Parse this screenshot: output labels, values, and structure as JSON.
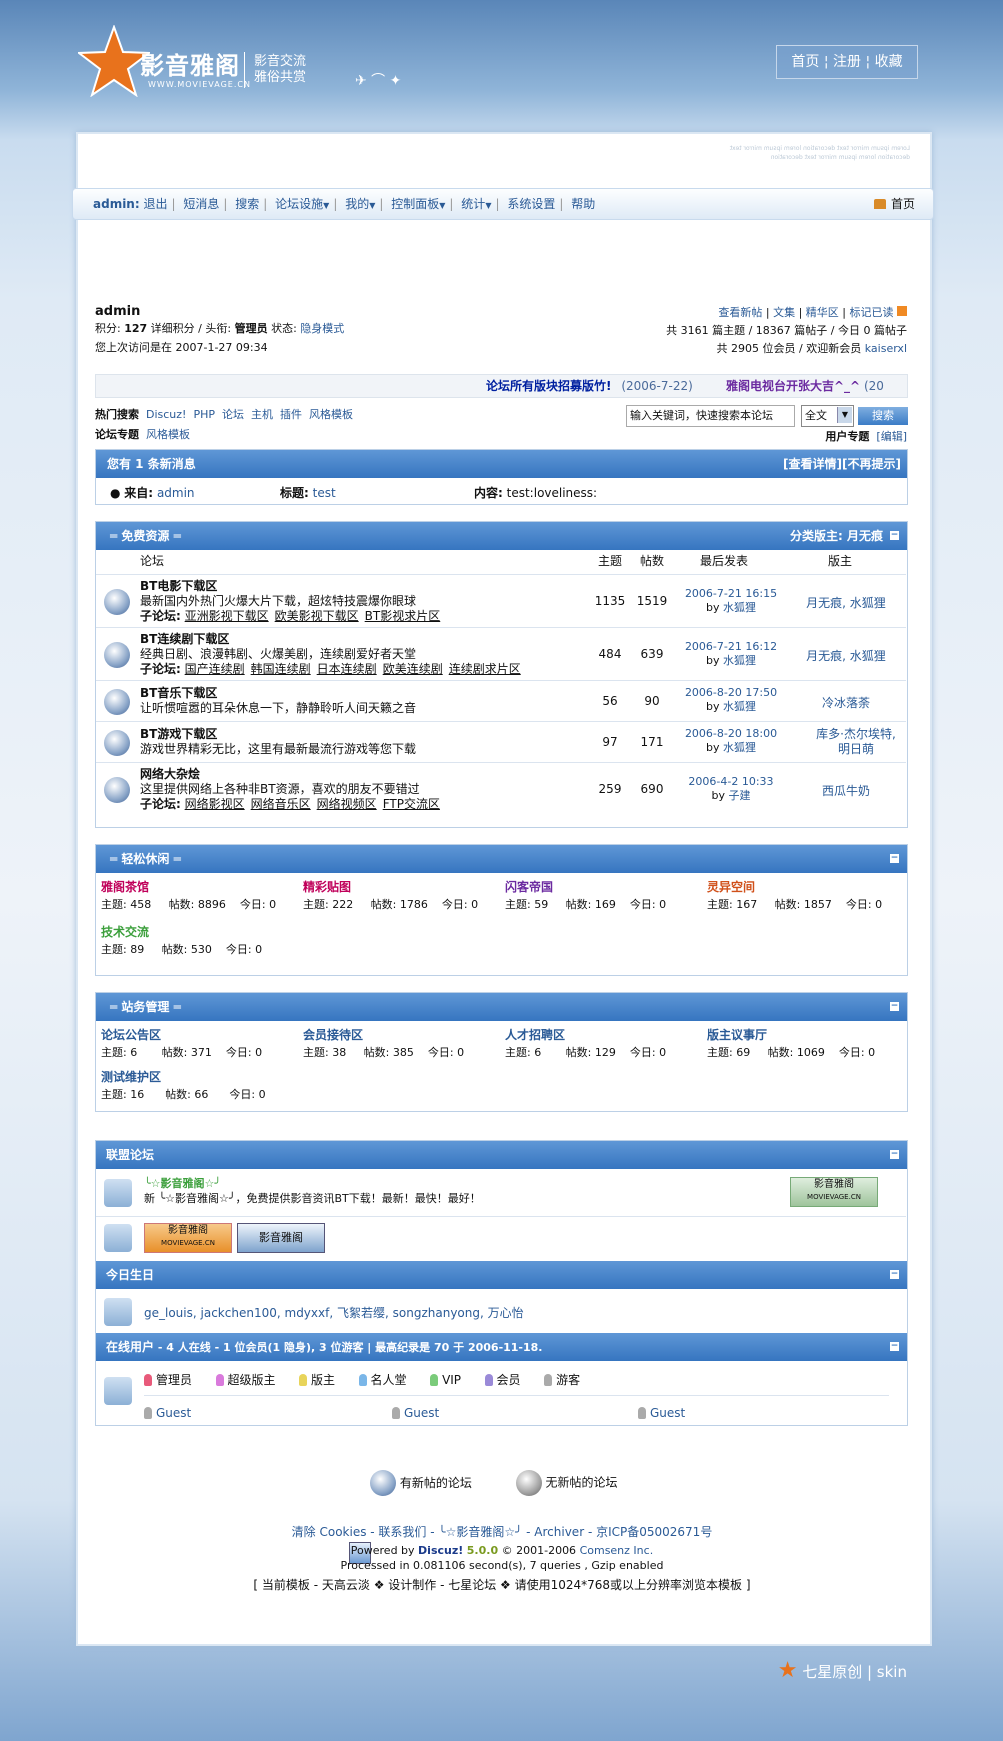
{
  "header": {
    "logo_text": "影音雅阁",
    "logo_url": "WWW.MOVIEVAGE.CN",
    "tagline1": "影音交流",
    "tagline2": "雅俗共赏",
    "toplinks": [
      "首页",
      "注册",
      "收藏"
    ]
  },
  "nav": {
    "user": "admin:",
    "items": [
      "退出",
      "短消息",
      "搜索",
      "论坛设施",
      "我的",
      "控制面板",
      "统计",
      "系统设置",
      "帮助"
    ],
    "home": "首页"
  },
  "user": {
    "name": "admin",
    "line1a": "积分: ",
    "points": "127",
    "line1b": " 详细积分 / 头衔: ",
    "title": "管理员",
    "line1c": " 状态: ",
    "status": "隐身模式",
    "last_visit": "您上次访问是在 2007-1-27 09:34"
  },
  "stats": {
    "links": [
      "查看新帖",
      "文集",
      "精华区",
      "标记已读"
    ],
    "line2": "共 3161 篇主题 / 18367 篇帖子 / 今日 0 篇帖子",
    "line3a": "共 2905 位会员 / 欢迎新会员 ",
    "newest": "kaiserxl"
  },
  "announce": {
    "a1": "论坛所有版块招募版竹!",
    "d1": "(2006-7-22)",
    "a2": "雅阁电视台开张大吉^_^",
    "d2": "(20"
  },
  "search": {
    "hot_label": "热门搜索",
    "hot": [
      "Discuz!",
      "PHP",
      "论坛",
      "主机",
      "插件",
      "风格模板"
    ],
    "topic_label": "论坛专题",
    "topic": "风格模板",
    "placeholder": "输入关键词，快速搜索本论坛",
    "scope": "全文",
    "button": "搜索",
    "userzone": "用户专题",
    "edit": "[编辑]"
  },
  "pm": {
    "header": "您有 1 条新消息",
    "view": "[查看详情]",
    "noshow": "[不再提示]",
    "from_label": "来自:",
    "from": "admin",
    "title_label": "标题:",
    "title": "test",
    "content_label": "内容:",
    "content": "test:loveliness:"
  },
  "cat1": {
    "name": "免费资源",
    "moderator": "分类版主: 月无痕",
    "cols": [
      "论坛",
      "主题",
      "帖数",
      "最后发表",
      "版主"
    ],
    "forums": [
      {
        "name": "BT电影下载区",
        "desc": "最新国内外热门火爆大片下载，超炫特技震爆你眼球",
        "sub_label": "子论坛:",
        "subs": [
          "亚洲影视下载区",
          "欧美影视下载区",
          "BT影视求片区"
        ],
        "topics": "1135",
        "posts": "1519",
        "last": "2006-7-21 16:15",
        "by": "by",
        "last_user": "水狐狸",
        "mods": "月无痕, 水狐狸"
      },
      {
        "name": "BT连续剧下载区",
        "desc": "经典日剧、浪漫韩剧、火爆美剧，连续剧爱好者天堂",
        "sub_label": "子论坛:",
        "subs": [
          "国产连续剧",
          "韩国连续剧",
          "日本连续剧",
          "欧美连续剧",
          "连续剧求片区"
        ],
        "topics": "484",
        "posts": "639",
        "last": "2006-7-21 16:12",
        "by": "by",
        "last_user": "水狐狸",
        "mods": "月无痕, 水狐狸"
      },
      {
        "name": "BT音乐下载区",
        "desc": "让听惯喧嚣的耳朵休息一下，静静聆听人间天籁之音",
        "sub_label": "",
        "subs": [],
        "topics": "56",
        "posts": "90",
        "last": "2006-8-20 17:50",
        "by": "by",
        "last_user": "水狐狸",
        "mods": "冷冰落荼"
      },
      {
        "name": "BT游戏下载区",
        "desc": "游戏世界精彩无比，这里有最新最流行游戏等您下载",
        "sub_label": "",
        "subs": [],
        "topics": "97",
        "posts": "171",
        "last": "2006-8-20 18:00",
        "by": "by",
        "last_user": "水狐狸",
        "mods": "库多·杰尔埃特, 明日萌"
      },
      {
        "name": "网络大杂烩",
        "desc": "这里提供网络上各种非BT资源，喜欢的朋友不要错过",
        "sub_label": "子论坛:",
        "subs": [
          "网络影视区",
          "网络音乐区",
          "网络视频区",
          "FTP交流区"
        ],
        "topics": "259",
        "posts": "690",
        "last": "2006-4-2 10:33",
        "by": "by",
        "last_user": "子建",
        "mods": "西瓜牛奶"
      }
    ]
  },
  "cat2": {
    "name": "轻松休闲",
    "forums": [
      {
        "name": "雅阁茶馆",
        "topics": "主题: 458",
        "posts": "帖数: 8896",
        "today": "今日: 0",
        "color": "#c0005a"
      },
      {
        "name": "精彩贴图",
        "topics": "主题: 222",
        "posts": "帖数: 1786",
        "today": "今日: 0",
        "color": "#c0005a"
      },
      {
        "name": "闪客帝国",
        "topics": "主题: 59",
        "posts": "帖数: 169",
        "today": "今日: 0",
        "color": "#6b2aa0"
      },
      {
        "name": "灵异空间",
        "topics": "主题: 167",
        "posts": "帖数: 1857",
        "today": "今日: 0",
        "color": "#d0501a"
      },
      {
        "name": "技术交流",
        "topics": "主题: 89",
        "posts": "帖数: 530",
        "today": "今日: 0",
        "color": "#3b9f3b"
      }
    ]
  },
  "cat3": {
    "name": "站务管理",
    "forums": [
      {
        "name": "论坛公告区",
        "topics": "主题: 6",
        "posts": "帖数: 371",
        "today": "今日: 0"
      },
      {
        "name": "会员接待区",
        "topics": "主题: 38",
        "posts": "帖数: 385",
        "today": "今日: 0"
      },
      {
        "name": "人才招聘区",
        "topics": "主题: 6",
        "posts": "帖数: 129",
        "today": "今日: 0"
      },
      {
        "name": "版主议事厅",
        "topics": "主题: 69",
        "posts": "帖数: 1069",
        "today": "今日: 0"
      },
      {
        "name": "测试维护区",
        "topics": "主题: 16",
        "posts": "帖数: 66",
        "today": "今日: 0"
      }
    ]
  },
  "links": {
    "header": "联盟论坛",
    "name": "╰☆影音雅阁☆╯",
    "desc": "新 ╰☆影音雅阁☆╯，免费提供影音资讯BT下载！最新！最快！最好！",
    "badge": "影音雅阁",
    "badge_url": "MOVIEVAGE.CN"
  },
  "birthday": {
    "header": "今日生日",
    "users": [
      "ge_louis",
      "jackchen100",
      "mdyxxf",
      "飞絮若缨",
      "songzhanyong",
      "万心怡"
    ]
  },
  "online": {
    "label": "在线用户",
    "summary": "- 4 人在线 - 1 位会员(1 隐身), 3 位游客 | 最高纪录是 70 于 2006-11-18.",
    "groups": [
      "管理员",
      "超级版主",
      "版主",
      "名人堂",
      "VIP",
      "会员",
      "游客"
    ],
    "guests": [
      "Guest",
      "Guest",
      "Guest"
    ]
  },
  "legend": {
    "new": "有新帖的论坛",
    "nonew": "无新帖的论坛"
  },
  "footer": {
    "links": "清除 Cookies - 联系我们 - ╰☆影音雅阁☆╯ - Archiver - 京ICP备05002671号",
    "powered": "Powered by ",
    "discuz": "Discuz!",
    "ver": "5.0.0",
    "copy": " © 2001-2006 ",
    "comsenz": "Comsenz Inc.",
    "processed": "Processed in 0.081106 second(s), 7 queries , Gzip enabled",
    "template": "[ 当前模板 - 天高云淡 ❖ 设计制作 - 七星论坛 ❖ 请使用1024*768或以上分辨率浏览本模板 ]"
  },
  "brand": {
    "skin": "七星原创 | skin"
  },
  "colors": {
    "header_blue": "#3675c0",
    "link": "#2a5a96"
  }
}
